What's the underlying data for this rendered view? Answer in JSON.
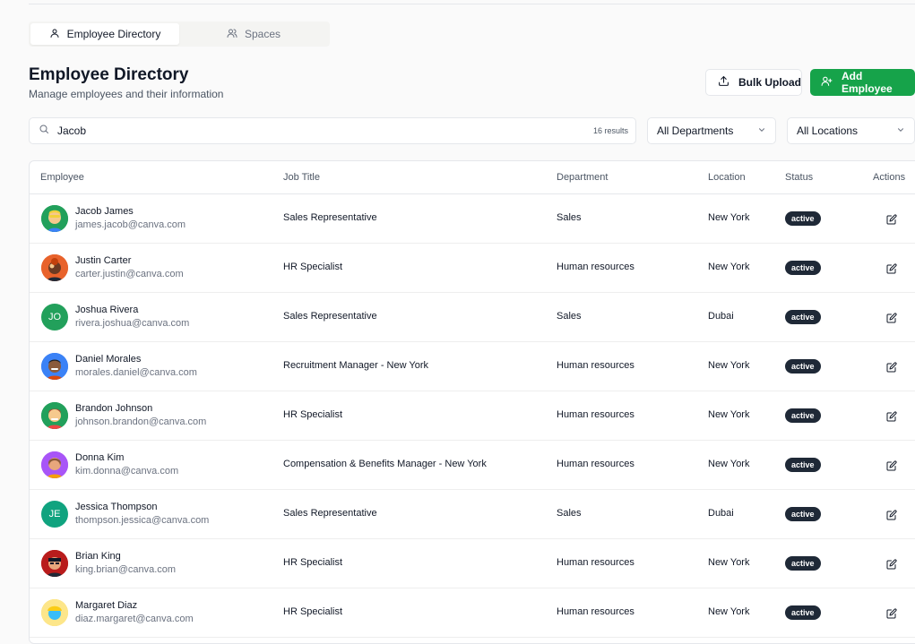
{
  "tabs": [
    {
      "label": "Employee Directory",
      "icon": "user-icon",
      "active": true
    },
    {
      "label": "Spaces",
      "icon": "users-icon",
      "active": false
    }
  ],
  "header": {
    "title": "Employee Directory",
    "subtitle": "Manage employees and their information",
    "bulk_upload_label": "Bulk Upload",
    "add_employee_label": "Add Employee"
  },
  "filters": {
    "search_value": "Jacob",
    "results_text": "16 results",
    "department_value": "All Departments",
    "location_value": "All Locations"
  },
  "table": {
    "columns": [
      "Employee",
      "Job Title",
      "Department",
      "Location",
      "Status",
      "Actions"
    ],
    "rows": [
      {
        "name": "Jacob James",
        "email": "james.jacob@canva.com",
        "job_title": "Sales Representative",
        "department": "Sales",
        "location": "New York",
        "status": "active",
        "avatar": "illustrated-avatar"
      },
      {
        "name": "Justin Carter",
        "email": "carter.justin@canva.com",
        "job_title": "HR Specialist",
        "department": "Human resources",
        "location": "New York",
        "status": "active",
        "avatar": "illustrated-avatar"
      },
      {
        "name": "Joshua Rivera",
        "email": "rivera.joshua@canva.com",
        "job_title": "Sales Representative",
        "department": "Sales",
        "location": "Dubai",
        "status": "active",
        "avatar_initials": "JO"
      },
      {
        "name": "Daniel Morales",
        "email": "morales.daniel@canva.com",
        "job_title": "Recruitment Manager - New York",
        "department": "Human resources",
        "location": "New York",
        "status": "active",
        "avatar": "illustrated-avatar"
      },
      {
        "name": "Brandon Johnson",
        "email": "johnson.brandon@canva.com",
        "job_title": "HR Specialist",
        "department": "Human resources",
        "location": "New York",
        "status": "active",
        "avatar": "illustrated-avatar"
      },
      {
        "name": "Donna Kim",
        "email": "kim.donna@canva.com",
        "job_title": "Compensation & Benefits Manager - New York",
        "department": "Human resources",
        "location": "New York",
        "status": "active",
        "avatar": "illustrated-avatar"
      },
      {
        "name": "Jessica Thompson",
        "email": "thompson.jessica@canva.com",
        "job_title": "Sales Representative",
        "department": "Sales",
        "location": "Dubai",
        "status": "active",
        "avatar_initials": "JE"
      },
      {
        "name": "Brian King",
        "email": "king.brian@canva.com",
        "job_title": "HR Specialist",
        "department": "Human resources",
        "location": "New York",
        "status": "active",
        "avatar": "illustrated-avatar"
      },
      {
        "name": "Margaret Diaz",
        "email": "diaz.margaret@canva.com",
        "job_title": "HR Specialist",
        "department": "Human resources",
        "location": "New York",
        "status": "active",
        "avatar": "illustrated-avatar"
      }
    ]
  },
  "colors": {
    "accent_green": "#16a34a",
    "badge_dark": "#1f2937",
    "avatar_green": "#22a05b",
    "avatar_teal": "#10a37f"
  },
  "icons": {
    "search": "search-icon",
    "upload": "upload-icon",
    "add_user": "user-plus-icon",
    "chevron": "chevron-down-icon",
    "edit": "edit-icon"
  }
}
